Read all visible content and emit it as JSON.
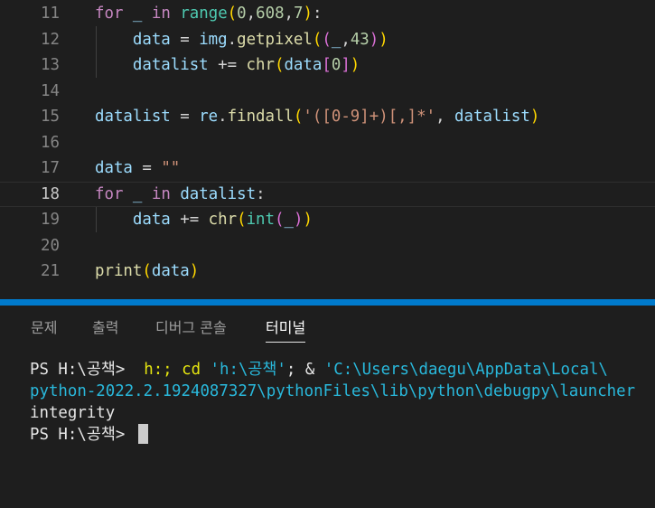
{
  "editor": {
    "active_line": "18",
    "lines": [
      {
        "n": "11",
        "tokens": [
          {
            "t": "for",
            "c": "kw"
          },
          {
            "t": " ",
            "c": "op"
          },
          {
            "t": "_",
            "c": "var"
          },
          {
            "t": " ",
            "c": "op"
          },
          {
            "t": "in",
            "c": "kw"
          },
          {
            "t": " ",
            "c": "op"
          },
          {
            "t": "range",
            "c": "bi"
          },
          {
            "t": "(",
            "c": "paren-y"
          },
          {
            "t": "0",
            "c": "num"
          },
          {
            "t": ",",
            "c": "punc"
          },
          {
            "t": "608",
            "c": "num"
          },
          {
            "t": ",",
            "c": "punc"
          },
          {
            "t": "7",
            "c": "num"
          },
          {
            "t": ")",
            "c": "paren-y"
          },
          {
            "t": ":",
            "c": "punc"
          }
        ]
      },
      {
        "n": "12",
        "tokens": [
          {
            "t": "    ",
            "c": "op"
          },
          {
            "t": "data",
            "c": "var"
          },
          {
            "t": " = ",
            "c": "op"
          },
          {
            "t": "img",
            "c": "var"
          },
          {
            "t": ".",
            "c": "punc"
          },
          {
            "t": "getpixel",
            "c": "fn"
          },
          {
            "t": "(",
            "c": "paren-y"
          },
          {
            "t": "(",
            "c": "paren-p"
          },
          {
            "t": "_",
            "c": "var"
          },
          {
            "t": ",",
            "c": "punc"
          },
          {
            "t": "43",
            "c": "num"
          },
          {
            "t": ")",
            "c": "paren-p"
          },
          {
            "t": ")",
            "c": "paren-y"
          }
        ]
      },
      {
        "n": "13",
        "tokens": [
          {
            "t": "    ",
            "c": "op"
          },
          {
            "t": "datalist",
            "c": "var"
          },
          {
            "t": " += ",
            "c": "op"
          },
          {
            "t": "chr",
            "c": "fn"
          },
          {
            "t": "(",
            "c": "paren-y"
          },
          {
            "t": "data",
            "c": "var"
          },
          {
            "t": "[",
            "c": "paren-p"
          },
          {
            "t": "0",
            "c": "num"
          },
          {
            "t": "]",
            "c": "paren-p"
          },
          {
            "t": ")",
            "c": "paren-y"
          }
        ]
      },
      {
        "n": "14",
        "tokens": []
      },
      {
        "n": "15",
        "tokens": [
          {
            "t": "datalist",
            "c": "var"
          },
          {
            "t": " = ",
            "c": "op"
          },
          {
            "t": "re",
            "c": "var"
          },
          {
            "t": ".",
            "c": "punc"
          },
          {
            "t": "findall",
            "c": "fn"
          },
          {
            "t": "(",
            "c": "paren-y"
          },
          {
            "t": "'",
            "c": "str"
          },
          {
            "t": "(",
            "c": "str"
          },
          {
            "t": "[0-9]",
            "c": "str"
          },
          {
            "t": "+",
            "c": "str"
          },
          {
            "t": ")",
            "c": "str"
          },
          {
            "t": "[,]",
            "c": "str"
          },
          {
            "t": "*",
            "c": "str"
          },
          {
            "t": "'",
            "c": "str"
          },
          {
            "t": ", ",
            "c": "punc"
          },
          {
            "t": "datalist",
            "c": "var"
          },
          {
            "t": ")",
            "c": "paren-y"
          }
        ]
      },
      {
        "n": "16",
        "tokens": []
      },
      {
        "n": "17",
        "tokens": [
          {
            "t": "data",
            "c": "var"
          },
          {
            "t": " = ",
            "c": "op"
          },
          {
            "t": "\"\"",
            "c": "str"
          }
        ]
      },
      {
        "n": "18",
        "tokens": [
          {
            "t": "for",
            "c": "kw"
          },
          {
            "t": " ",
            "c": "op"
          },
          {
            "t": "_",
            "c": "var"
          },
          {
            "t": " ",
            "c": "op"
          },
          {
            "t": "in",
            "c": "kw"
          },
          {
            "t": " ",
            "c": "op"
          },
          {
            "t": "datalist",
            "c": "var"
          },
          {
            "t": ":",
            "c": "punc"
          }
        ]
      },
      {
        "n": "19",
        "tokens": [
          {
            "t": "    ",
            "c": "op"
          },
          {
            "t": "data",
            "c": "var"
          },
          {
            "t": " += ",
            "c": "op"
          },
          {
            "t": "chr",
            "c": "fn"
          },
          {
            "t": "(",
            "c": "paren-y"
          },
          {
            "t": "int",
            "c": "bi"
          },
          {
            "t": "(",
            "c": "paren-p"
          },
          {
            "t": "_",
            "c": "var"
          },
          {
            "t": ")",
            "c": "paren-p"
          },
          {
            "t": ")",
            "c": "paren-y"
          }
        ]
      },
      {
        "n": "20",
        "tokens": []
      },
      {
        "n": "21",
        "tokens": [
          {
            "t": "print",
            "c": "fn"
          },
          {
            "t": "(",
            "c": "paren-y"
          },
          {
            "t": "data",
            "c": "var"
          },
          {
            "t": ")",
            "c": "paren-y"
          }
        ]
      }
    ]
  },
  "panel": {
    "tabs": [
      {
        "label": "문제",
        "active": false
      },
      {
        "label": "출력",
        "active": false
      },
      {
        "label": "디버그 콘솔",
        "active": false
      },
      {
        "label": "터미널",
        "active": true
      }
    ],
    "terminal": {
      "line1": [
        {
          "t": "PS H:\\공책> ",
          "c": "t-white"
        },
        {
          "t": " h:; cd ",
          "c": "t-yellow"
        },
        {
          "t": "'h:\\공책'",
          "c": "t-cyan"
        },
        {
          "t": "; & ",
          "c": "t-white"
        },
        {
          "t": "'C:\\Users\\daegu\\AppData\\Local\\",
          "c": "t-cyan"
        }
      ],
      "line2": "python-2022.2.1924087327\\pythonFiles\\lib\\python\\debugpy\\launcher",
      "line3": "integrity",
      "line4_prompt": "PS H:\\공책> "
    }
  }
}
